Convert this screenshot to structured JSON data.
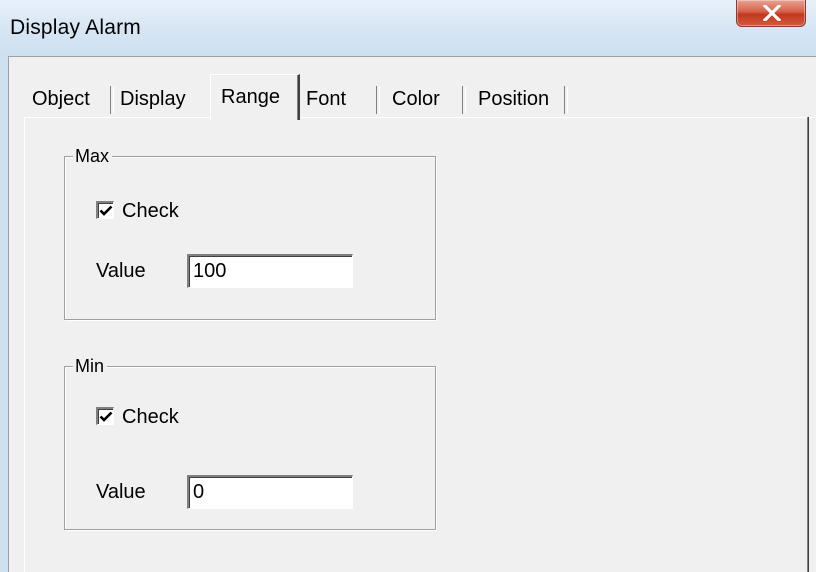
{
  "window": {
    "title": "Display Alarm",
    "close_glyph": "X"
  },
  "tabs": [
    {
      "label": "Object",
      "active": false
    },
    {
      "label": "Display",
      "active": false
    },
    {
      "label": "Range",
      "active": true
    },
    {
      "label": "Font",
      "active": false
    },
    {
      "label": "Color",
      "active": false
    },
    {
      "label": "Position",
      "active": false
    }
  ],
  "range": {
    "max": {
      "caption": "Max",
      "check_label": "Check",
      "checked": true,
      "value_label": "Value",
      "value": "100"
    },
    "min": {
      "caption": "Min",
      "check_label": "Check",
      "checked": true,
      "value_label": "Value",
      "value": "0"
    }
  },
  "colors": {
    "close_button": "#c2381f",
    "dialog_face": "#f0f0f0",
    "title_bar": "#d9e7f4"
  },
  "icons": {
    "close": "close-icon",
    "check": "checkmark-icon"
  }
}
